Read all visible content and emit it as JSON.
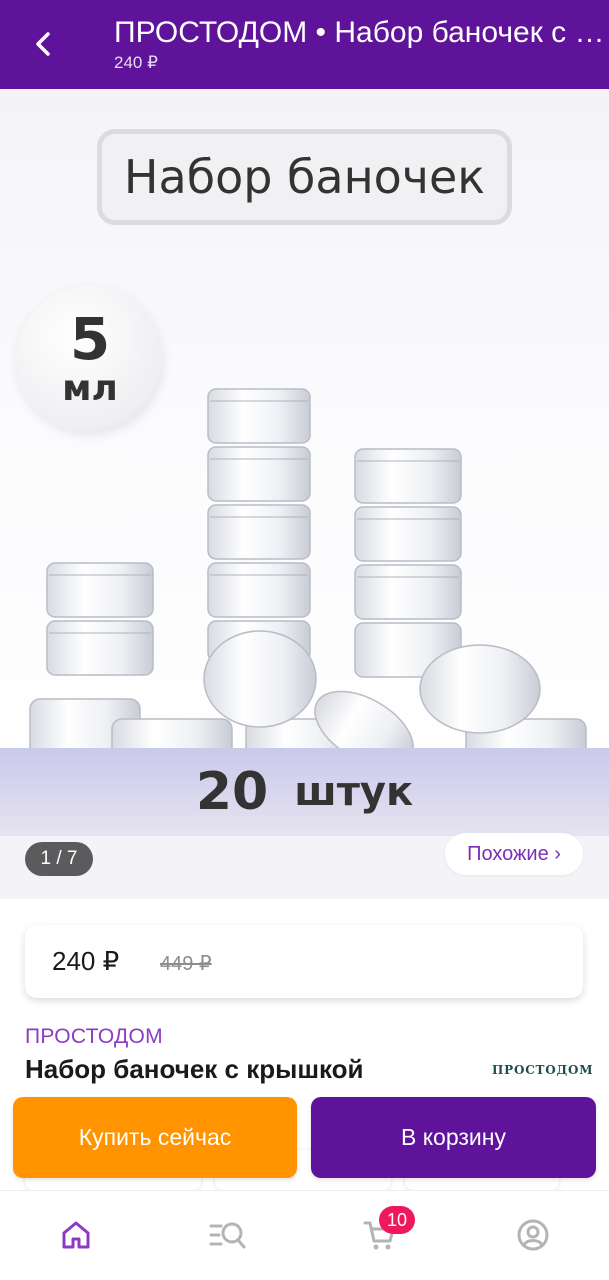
{
  "header": {
    "title": "ПРОСТОДОМ • Набор баночек с крышкой",
    "price": "240 ₽",
    "back_icon": "arrow-left-icon"
  },
  "gallery": {
    "photo_title": "Набор баночек",
    "volume_number": "5",
    "volume_unit": "мл",
    "pieces_number": "20",
    "pieces_unit": "штук",
    "counter": "1 / 7",
    "similar_label": "Похожие ›"
  },
  "price": {
    "current": "240 ₽",
    "old": "449 ₽"
  },
  "product": {
    "brand": "ПРОСТОДОМ",
    "name_line1": "Набор баночек с крышкой",
    "brand_logo": "ПРОСТОДОМ"
  },
  "actions": {
    "buy_now": "Купить сейчас",
    "add_to_cart": "В корзину"
  },
  "bottom_nav": {
    "items": [
      {
        "icon": "home-icon",
        "active": true
      },
      {
        "icon": "catalog-search-icon",
        "active": false
      },
      {
        "icon": "cart-icon",
        "active": false,
        "badge": "10"
      },
      {
        "icon": "profile-icon",
        "active": false
      }
    ]
  },
  "colors": {
    "brand_purple": "#5f139b",
    "accent_orange": "#ff9400",
    "badge_pink": "#f0185c",
    "brand_text_purple": "#8b3cc6"
  }
}
